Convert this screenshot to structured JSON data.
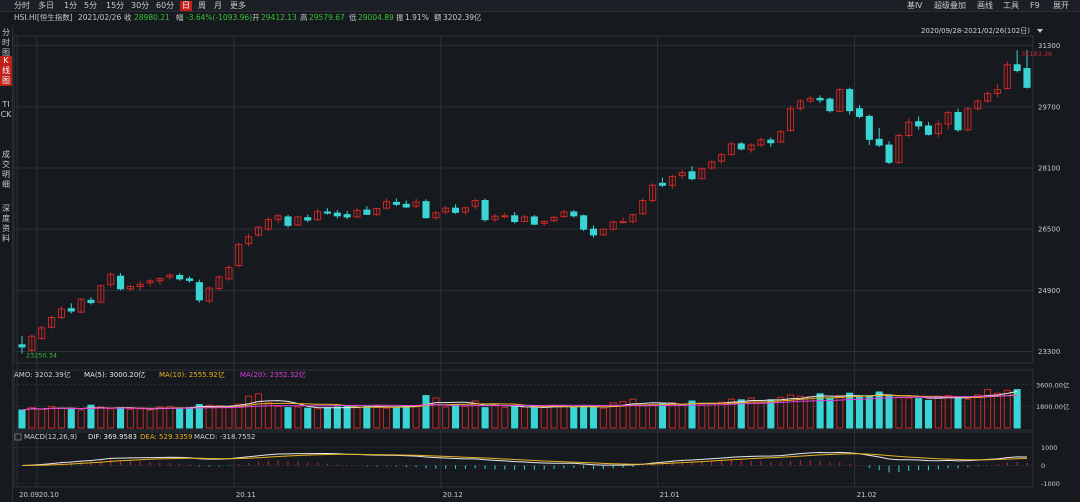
{
  "toolbar": {
    "periods": [
      "分时",
      "多日",
      "1分",
      "5分",
      "15分",
      "30分",
      "60分",
      "日",
      "周",
      "月",
      "更多"
    ],
    "active_period": "日",
    "right_items": [
      "基Ⅳ",
      "超级叠加",
      "画线",
      "工具",
      "F9",
      "展开"
    ]
  },
  "info": {
    "symbol": "HSI.HI[恒生指数]",
    "date": "2021/02/26",
    "close_label": "收",
    "close": "28980.21",
    "change_label": "幅",
    "change": "-3.64%(-1093.96)",
    "open_label": "开",
    "open": "29412.13",
    "high_label": "高",
    "high": "29579.67",
    "low_label": "低",
    "low": "29004.89",
    "amplitude_label": "振",
    "amplitude": "1.91%",
    "amount_label": "额",
    "amount": "3202.39亿"
  },
  "sidebar": {
    "tabs": [
      "分时图",
      "K线图",
      "TICK",
      "成交明细",
      "深度资料"
    ],
    "active": "K线图"
  },
  "colors": {
    "up": "#c82828",
    "down": "#3ad4d4",
    "ma5": "#e8e8e8",
    "ma10": "#e8b020",
    "ma20": "#e040e0",
    "dif": "#e8e8e8",
    "dea": "#e8b020",
    "grid": "#2c3038",
    "background": "#161a1e"
  },
  "chart_data": {
    "type": "candlestick",
    "range_label": "2020/09/28-2021/02/26(102日)",
    "price_axis_ticks": [
      "31300",
      "29700",
      "28100",
      "26500",
      "24900",
      "23300"
    ],
    "ylim": [
      23000,
      31500
    ],
    "max_label": "31183.36",
    "min_label": "23250.34",
    "x_axis_ticks": [
      {
        "label": "20.09",
        "index": 0
      },
      {
        "label": "20.10",
        "index": 2
      },
      {
        "label": "20.11",
        "index": 22
      },
      {
        "label": "20.12",
        "index": 43
      },
      {
        "label": "21.01",
        "index": 65
      },
      {
        "label": "21.02",
        "index": 85
      }
    ],
    "candles": [
      [
        23476,
        23700,
        23250,
        23420
      ],
      [
        23330,
        23750,
        23250,
        23700
      ],
      [
        23640,
        23980,
        23600,
        23920
      ],
      [
        23935,
        24240,
        23900,
        24190
      ],
      [
        24190,
        24480,
        24150,
        24410
      ],
      [
        24420,
        24560,
        24300,
        24360
      ],
      [
        24330,
        24700,
        24300,
        24670
      ],
      [
        24640,
        24720,
        24530,
        24580
      ],
      [
        24590,
        25050,
        24560,
        25020
      ],
      [
        25050,
        25370,
        24980,
        25320
      ],
      [
        25270,
        25350,
        24900,
        24940
      ],
      [
        24940,
        25050,
        24880,
        25000
      ],
      [
        25000,
        25150,
        24900,
        25060
      ],
      [
        25100,
        25210,
        25000,
        25150
      ],
      [
        25150,
        25250,
        25050,
        25210
      ],
      [
        25250,
        25350,
        25180,
        25300
      ],
      [
        25290,
        25350,
        25150,
        25200
      ],
      [
        25200,
        25270,
        25100,
        25160
      ],
      [
        25100,
        25180,
        24580,
        24650
      ],
      [
        24620,
        25000,
        24560,
        24960
      ],
      [
        24950,
        25300,
        24900,
        25250
      ],
      [
        25200,
        25550,
        25150,
        25500
      ],
      [
        25550,
        26150,
        25500,
        26100
      ],
      [
        26120,
        26380,
        26050,
        26300
      ],
      [
        26350,
        26580,
        26300,
        26550
      ],
      [
        26500,
        26820,
        26450,
        26750
      ],
      [
        26750,
        26900,
        26650,
        26850
      ],
      [
        26820,
        26880,
        26540,
        26600
      ],
      [
        26610,
        26850,
        26580,
        26820
      ],
      [
        26800,
        26880,
        26680,
        26740
      ],
      [
        26750,
        27030,
        26720,
        26960
      ],
      [
        26950,
        27050,
        26880,
        26920
      ],
      [
        26920,
        27000,
        26780,
        26850
      ],
      [
        26880,
        26980,
        26760,
        26820
      ],
      [
        26820,
        27050,
        26800,
        26990
      ],
      [
        27000,
        27100,
        26870,
        26890
      ],
      [
        26880,
        27060,
        26850,
        27040
      ],
      [
        27050,
        27300,
        27020,
        27220
      ],
      [
        27200,
        27300,
        27100,
        27150
      ],
      [
        27150,
        27250,
        27050,
        27080
      ],
      [
        27100,
        27300,
        27050,
        27210
      ],
      [
        27220,
        27280,
        26780,
        26800
      ],
      [
        26800,
        26980,
        26750,
        26930
      ],
      [
        26950,
        27100,
        26880,
        27050
      ],
      [
        27050,
        27150,
        26900,
        26940
      ],
      [
        26950,
        27100,
        26880,
        27060
      ],
      [
        27100,
        27300,
        27030,
        27250
      ],
      [
        27250,
        27300,
        26700,
        26750
      ],
      [
        26750,
        26900,
        26680,
        26840
      ],
      [
        26840,
        26930,
        26780,
        26850
      ],
      [
        26850,
        26950,
        26650,
        26700
      ],
      [
        26700,
        26880,
        26680,
        26820
      ],
      [
        26820,
        26870,
        26600,
        26630
      ],
      [
        26650,
        26740,
        26580,
        26700
      ],
      [
        26720,
        26850,
        26680,
        26810
      ],
      [
        26830,
        27000,
        26800,
        26950
      ],
      [
        26950,
        27000,
        26800,
        26850
      ],
      [
        26850,
        26880,
        26450,
        26500
      ],
      [
        26500,
        26600,
        26280,
        26350
      ],
      [
        26350,
        26520,
        26330,
        26500
      ],
      [
        26500,
        26720,
        26460,
        26690
      ],
      [
        26700,
        26800,
        26650,
        26700
      ],
      [
        26700,
        26900,
        26650,
        26880
      ],
      [
        26900,
        27300,
        26880,
        27250
      ],
      [
        27250,
        27700,
        27200,
        27650
      ],
      [
        27700,
        27850,
        27600,
        27650
      ],
      [
        27650,
        27920,
        27550,
        27880
      ],
      [
        27900,
        28050,
        27800,
        27980
      ],
      [
        28000,
        28150,
        27780,
        27820
      ],
      [
        27820,
        28120,
        27800,
        28080
      ],
      [
        28100,
        28300,
        28050,
        28260
      ],
      [
        28280,
        28500,
        28200,
        28450
      ],
      [
        28450,
        28780,
        28420,
        28730
      ],
      [
        28730,
        28780,
        28560,
        28600
      ],
      [
        28580,
        28750,
        28500,
        28700
      ],
      [
        28700,
        28900,
        28650,
        28840
      ],
      [
        28830,
        28900,
        28650,
        28760
      ],
      [
        28780,
        29100,
        28750,
        29050
      ],
      [
        29080,
        29730,
        29050,
        29650
      ],
      [
        29660,
        29900,
        29600,
        29850
      ],
      [
        29850,
        30000,
        29800,
        29920
      ],
      [
        29920,
        30000,
        29800,
        29880
      ],
      [
        29900,
        29950,
        29550,
        29600
      ],
      [
        29580,
        30200,
        29550,
        30150
      ],
      [
        30150,
        30200,
        29500,
        29600
      ],
      [
        29650,
        29750,
        29400,
        29450
      ],
      [
        29450,
        29500,
        28700,
        28850
      ],
      [
        28850,
        29150,
        28650,
        28700
      ],
      [
        28700,
        28800,
        28200,
        28250
      ],
      [
        28250,
        29000,
        28200,
        28950
      ],
      [
        28950,
        29400,
        28900,
        29300
      ],
      [
        29310,
        29450,
        29100,
        29200
      ],
      [
        29200,
        29300,
        28950,
        28980
      ],
      [
        29000,
        29350,
        28900,
        29250
      ],
      [
        29250,
        29600,
        29100,
        29550
      ],
      [
        29550,
        29650,
        29050,
        29100
      ],
      [
        29100,
        29700,
        29050,
        29650
      ],
      [
        29650,
        29900,
        29600,
        29850
      ],
      [
        29850,
        30100,
        29800,
        30050
      ],
      [
        30050,
        30300,
        29950,
        30150
      ],
      [
        30180,
        30900,
        30150,
        30800
      ],
      [
        30800,
        31183,
        30600,
        30650
      ],
      [
        30700,
        31183,
        30180,
        30210
      ]
    ],
    "amo": {
      "label": "AMO:",
      "value": "3202.39亿",
      "ma5_label": "MA(5):",
      "ma5": "3000.20亿",
      "ma10_label": "MA(10):",
      "ma10": "2555.92亿",
      "ma20_label": "MA(20):",
      "ma20": "2352.32亿",
      "axis_ticks": [
        "3600.00亿",
        "1800.00亿"
      ],
      "ylim": [
        0,
        4000
      ],
      "values": [
        1500,
        1700,
        1550,
        1800,
        1650,
        1600,
        1500,
        1900,
        1750,
        1600,
        1700,
        1550,
        1600,
        1500,
        1750,
        1800,
        1650,
        1700,
        1950,
        1900,
        1850,
        1700,
        2000,
        2650,
        2850,
        2100,
        1800,
        1700,
        1750,
        1650,
        1600,
        1700,
        1750,
        1800,
        1700,
        1800,
        1900,
        1650,
        1750,
        1850,
        1800,
        2700,
        2500,
        1750,
        1950,
        1800,
        2250,
        1700,
        1850,
        1700,
        1800,
        1750,
        1650,
        1700,
        1900,
        1850,
        1750,
        1800,
        1700,
        1650,
        2100,
        2200,
        2400,
        1850,
        1950,
        2000,
        2100,
        1900,
        2250,
        1950,
        2050,
        2150,
        2400,
        2350,
        2500,
        2050,
        2350,
        2550,
        2750,
        2650,
        2600,
        2850,
        2450,
        2700,
        2900,
        2550,
        2700,
        3000,
        2650,
        2550,
        2500,
        2450,
        2300,
        2650,
        2700,
        2500,
        2400,
        2750,
        3200,
        2900,
        3150,
        3200
      ]
    },
    "macd": {
      "params": "MACD(12,26,9)",
      "dif_label": "DIF:",
      "dif": "369.9583",
      "dea_label": "DEA:",
      "dea": "529.3359",
      "macd_label": "MACD:",
      "macd": "-318.7552",
      "axis_ticks": [
        "1000",
        "0",
        "-1000"
      ]
    }
  }
}
